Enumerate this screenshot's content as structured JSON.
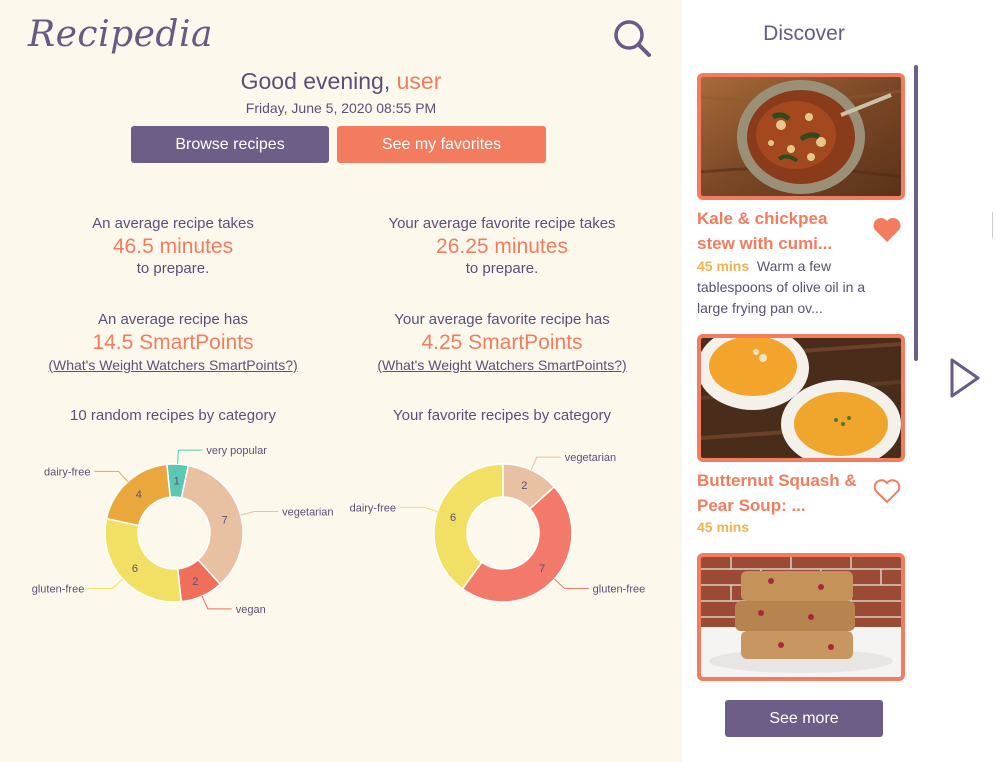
{
  "app": {
    "logo": "Recipedia",
    "search_icon": "search-icon"
  },
  "greeting": {
    "prefix": "Good evening, ",
    "name": "user",
    "date": "Friday, June 5, 2020 08:55 PM"
  },
  "buttons": {
    "browse": "Browse recipes",
    "favorites": "See my favorites"
  },
  "stats": {
    "avg_time": {
      "label": "An average recipe takes",
      "value": "46.5 minutes",
      "suffix": "to prepare."
    },
    "fav_time": {
      "label": "Your average favorite recipe takes",
      "value": "26.25 minutes",
      "suffix": "to prepare."
    },
    "avg_points": {
      "label": "An average recipe has",
      "value": "14.5 SmartPoints",
      "link": "(What's Weight Watchers SmartPoints?)"
    },
    "fav_points": {
      "label": "Your average favorite recipe has",
      "value": "4.25 SmartPoints",
      "link": "(What's Weight Watchers SmartPoints?)"
    }
  },
  "colors": {
    "accent": "#f47c5e",
    "primary": "#6c5e86",
    "mins": "#f0b14f",
    "background": "#fcf9ec"
  },
  "chart_data": [
    {
      "type": "pie",
      "title": "10 random recipes by category",
      "slices": [
        {
          "label": "very popular",
          "value": 1,
          "color": "#5bc8b4"
        },
        {
          "label": "vegetarian",
          "value": 7,
          "color": "#e8c0a2"
        },
        {
          "label": "vegan",
          "value": 2,
          "color": "#ef6f5b"
        },
        {
          "label": "gluten-free",
          "value": 6,
          "color": "#f2e064"
        },
        {
          "label": "dairy-free",
          "value": 4,
          "color": "#eaa73c"
        }
      ]
    },
    {
      "type": "pie",
      "title": "Your favorite recipes by category",
      "slices": [
        {
          "label": "vegetarian",
          "value": 2,
          "color": "#e8c0a2"
        },
        {
          "label": "gluten-free",
          "value": 7,
          "color": "#f3796a"
        },
        {
          "label": "dairy-free",
          "value": 6,
          "color": "#f2e064"
        }
      ]
    }
  ],
  "discover": {
    "title": "Discover",
    "see_more": "See more",
    "recipes": [
      {
        "title": "Kale & chickpea stew with cumi...",
        "mins": "45 mins",
        "desc": "Warm a few tablespoons of olive oil in a large frying pan ov...",
        "favorited": true
      },
      {
        "title": "Butternut Squash & Pear Soup: ...",
        "mins": "45 mins",
        "desc": "",
        "favorited": false
      }
    ]
  }
}
